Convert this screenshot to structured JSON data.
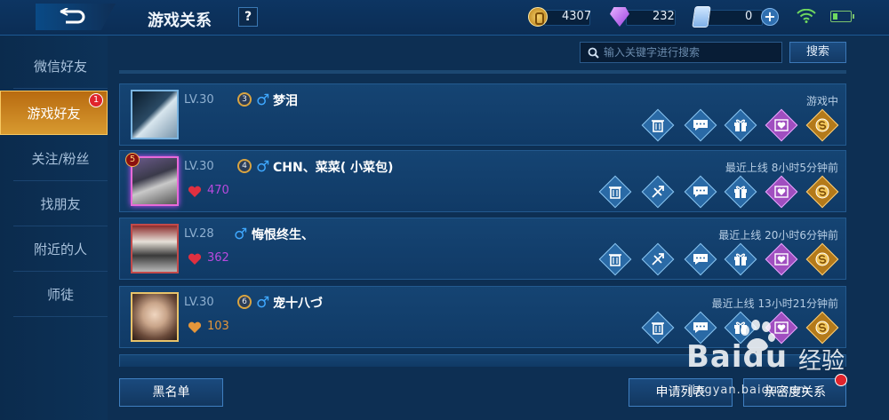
{
  "header": {
    "title": "游戏关系",
    "help_label": "?",
    "gold": "4307",
    "gems": "232",
    "coupons": "0"
  },
  "sidebar": {
    "items": [
      {
        "label": "微信好友"
      },
      {
        "label": "游戏好友",
        "badge": "1"
      },
      {
        "label": "关注/粉丝"
      },
      {
        "label": "找朋友"
      },
      {
        "label": "附近的人"
      },
      {
        "label": "师徒"
      }
    ]
  },
  "search": {
    "placeholder": "输入关键字进行搜索",
    "button_label": "搜索"
  },
  "friends": [
    {
      "level": "LV.30",
      "tier": "3",
      "name": "梦泪",
      "status": "游戏中",
      "intimacy": ""
    },
    {
      "level": "LV.30",
      "tier": "4",
      "name": "CHN、菜菜( 小菜包)",
      "status": "最近上线  8小时5分钟前",
      "intimacy": "470",
      "rank": "5"
    },
    {
      "level": "LV.28",
      "tier": "",
      "name": "悔恨终生、",
      "status": "最近上线  20小时6分钟前",
      "intimacy": "362"
    },
    {
      "level": "LV.30",
      "tier": "6",
      "name": "宠十八づ",
      "status": "最近上线  13小时21分钟前",
      "intimacy": "103"
    }
  ],
  "footer": {
    "blacklist_label": "黑名单",
    "apply_list_label": "申请列表",
    "intimate_label": "亲密度关系"
  },
  "watermark": {
    "brand": "Baidu",
    "cn": "经验",
    "url": "jingyan.baidu.com"
  },
  "colors": {
    "intimacy_red": "#b94adf",
    "intimacy_orange": "#e5963a",
    "accent_gold": "#d89a30"
  }
}
